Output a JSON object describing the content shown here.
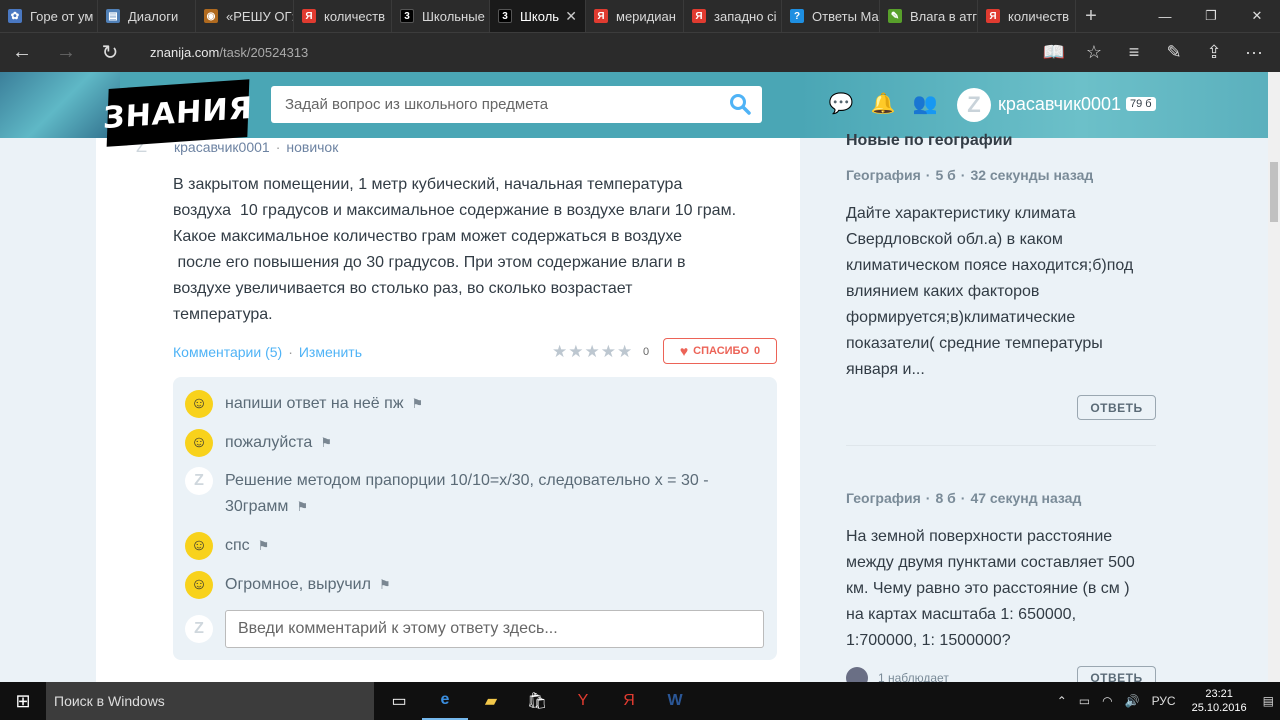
{
  "browser": {
    "tabs": [
      {
        "label": "Горе от ум",
        "icon": "tab-icon-1",
        "color": "#4a78c2"
      },
      {
        "label": "Диалоги",
        "icon": "tab-icon-2",
        "color": "#5181b8"
      },
      {
        "label": "«РЕШУ ОГ:",
        "icon": "tab-icon-3",
        "color": "#b06a1f"
      },
      {
        "label": "количеств",
        "icon": "tab-icon-4",
        "color": "#e03b30"
      },
      {
        "label": "Школьные",
        "icon": "tab-icon-5",
        "color": "#000000"
      },
      {
        "label": "Школь",
        "icon": "tab-icon-6",
        "color": "#000000",
        "active": true
      },
      {
        "label": "меридиан",
        "icon": "tab-icon-7",
        "color": "#e03b30"
      },
      {
        "label": "западно сі",
        "icon": "tab-icon-8",
        "color": "#e03b30"
      },
      {
        "label": "Ответы Ма",
        "icon": "tab-icon-9",
        "color": "#1e8fe1"
      },
      {
        "label": "Влага в атг",
        "icon": "tab-icon-10",
        "color": "#58a02b"
      },
      {
        "label": "количеств",
        "icon": "tab-icon-11",
        "color": "#e03b30"
      }
    ],
    "url_host": "znanija.com",
    "url_path": "/task/20524313"
  },
  "header": {
    "logo_text": "ЗНАНИЯ",
    "search_placeholder": "Задай вопрос из школьного предмета",
    "user_name": "красавчик0001",
    "user_points": "79 б"
  },
  "question": {
    "author": "красавчик0001",
    "rank": "новичок",
    "lines": [
      "В закрытом помещении, 1 метр кубический, начальная температура",
      "воздуха  10 градусов и максимальное содержание в воздухе влаги 10 грам.",
      "Какое максимальное количество грам может содержаться в воздухе",
      " после его повышения до 30 градусов. При этом содержание влаги в",
      "воздухе увеличивается во столько раз, во сколько возрастает",
      "температура."
    ],
    "comments_link": "Комментарии (5)",
    "edit_link": "Изменить",
    "rating_count": "0",
    "thanks_label": "СПАСИБО",
    "thanks_count": "0"
  },
  "comments": [
    {
      "text": "напиши ответ на неё пж"
    },
    {
      "text": "пожалуйста"
    },
    {
      "text": "Решение методом прапорции 10/10=x/30, следовательно x = 30 - 30грамм"
    },
    {
      "text": "спс"
    },
    {
      "text": "Огромное, выручил"
    }
  ],
  "comment_input_placeholder": "Введи комментарий к этому ответу здесь...",
  "sidebar": {
    "title": "Новые по географии",
    "items": [
      {
        "subject": "География",
        "points": "5 б",
        "time": "32 секунды назад",
        "lines": [
          "Дайте характеристику климата",
          "Свердловской обл.а) в каком",
          "климатическом поясе находится;б)под",
          "влиянием каких факторов",
          "формируется;в)климатические",
          "показатели( средние температуры",
          "января и..."
        ],
        "button": "ОТВЕТЬ"
      },
      {
        "subject": "География",
        "points": "8 б",
        "time": "47 секунд назад",
        "lines": [
          "На земной поверхности расстояние",
          "между двумя пунктами составляет 500",
          "км. Чему равно это расстояние (в см )",
          "на картах масштаба 1: 650000,",
          "1:700000, 1: 1500000?"
        ],
        "button": "ОТВЕТЬ",
        "watchers": "1 наблюдает"
      }
    ]
  },
  "taskbar": {
    "search_placeholder": "Поиск в Windows",
    "lang": "РУС",
    "time": "23:21",
    "date": "25.10.2016"
  },
  "colors": {
    "brand": "#4aa6b5",
    "link": "#4fb3f6",
    "thanks": "#ec6357"
  }
}
